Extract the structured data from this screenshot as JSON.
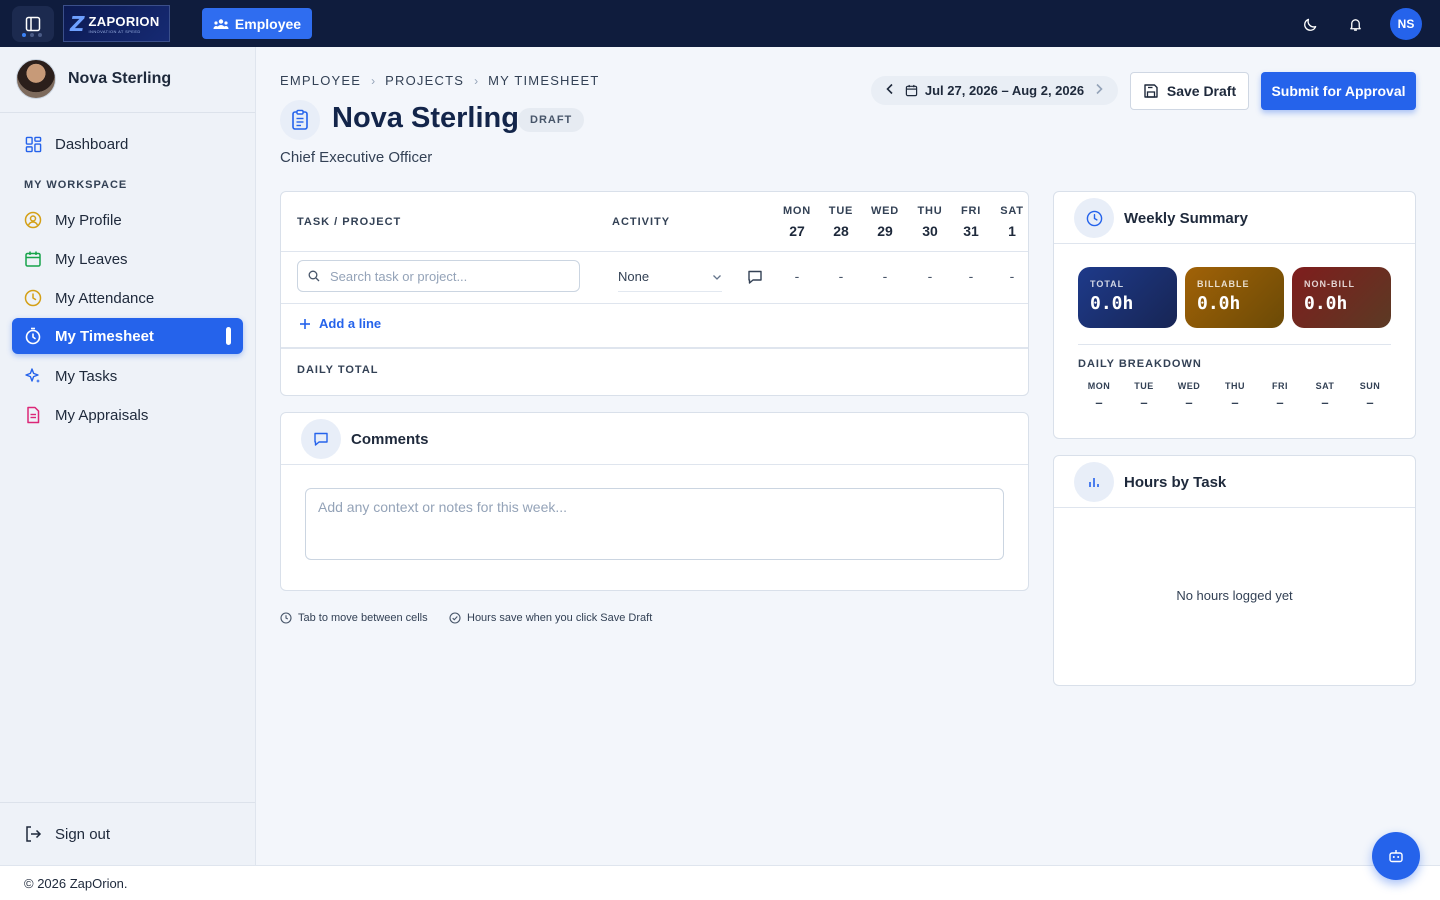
{
  "topbar": {
    "logo_name": "ZAPORION",
    "logo_tagline": "INNOVATION AT SPEED",
    "role_button": "Employee",
    "user_initials": "NS"
  },
  "sidebar": {
    "user_name": "Nova Sterling",
    "dashboard": "Dashboard",
    "section_label": "MY WORKSPACE",
    "items": [
      {
        "label": "My Profile",
        "icon": "user-circle-icon"
      },
      {
        "label": "My Leaves",
        "icon": "calendar-icon"
      },
      {
        "label": "My Attendance",
        "icon": "clock-icon"
      },
      {
        "label": "My Timesheet",
        "icon": "stopwatch-icon",
        "active": true
      },
      {
        "label": "My Tasks",
        "icon": "sparkle-icon"
      },
      {
        "label": "My Appraisals",
        "icon": "document-icon"
      }
    ],
    "sign_out": "Sign out"
  },
  "header": {
    "breadcrumb": [
      "EMPLOYEE",
      "PROJECTS",
      "MY TIMESHEET"
    ],
    "title": "Nova Sterling",
    "status_badge": "DRAFT",
    "subtitle": "Chief Executive Officer",
    "week_range": "Jul 27, 2026 – Aug 2, 2026",
    "save_draft": "Save Draft",
    "submit": "Submit for Approval"
  },
  "timesheet": {
    "col_task": "TASK / PROJECT",
    "col_activity": "ACTIVITY",
    "days": [
      {
        "name": "MON",
        "date": "27"
      },
      {
        "name": "TUE",
        "date": "28"
      },
      {
        "name": "WED",
        "date": "29"
      },
      {
        "name": "THU",
        "date": "30"
      },
      {
        "name": "FRI",
        "date": "31"
      },
      {
        "name": "SAT",
        "date": "1"
      }
    ],
    "row": {
      "search_placeholder": "Search task or project...",
      "activity": "None",
      "hours": [
        "-",
        "-",
        "-",
        "-",
        "-",
        "-"
      ]
    },
    "add_line": "Add a line",
    "daily_total": "DAILY TOTAL"
  },
  "comments": {
    "title": "Comments",
    "placeholder": "Add any context or notes for this week..."
  },
  "hints": {
    "tab": "Tab to move between cells",
    "save": "Hours save when you click Save Draft"
  },
  "weekly_summary": {
    "title": "Weekly Summary",
    "total_label": "TOTAL",
    "total_value": "0.0h",
    "billable_label": "BILLABLE",
    "billable_value": "0.0h",
    "nonbill_label": "NON-BILL",
    "nonbill_value": "0.0h",
    "breakdown_label": "DAILY BREAKDOWN",
    "breakdown": [
      {
        "day": "MON",
        "value": "–"
      },
      {
        "day": "TUE",
        "value": "–"
      },
      {
        "day": "WED",
        "value": "–"
      },
      {
        "day": "THU",
        "value": "–"
      },
      {
        "day": "FRI",
        "value": "–"
      },
      {
        "day": "SAT",
        "value": "–"
      },
      {
        "day": "SUN",
        "value": "–"
      }
    ],
    "colors": {
      "total": "#1e3a8a",
      "billable": "#a16207",
      "nonbill": "#7f1d1d"
    }
  },
  "hours_by_task": {
    "title": "Hours by Task",
    "empty": "No hours logged yet"
  },
  "footer": {
    "copyright": "© 2026 ZapOrion."
  }
}
